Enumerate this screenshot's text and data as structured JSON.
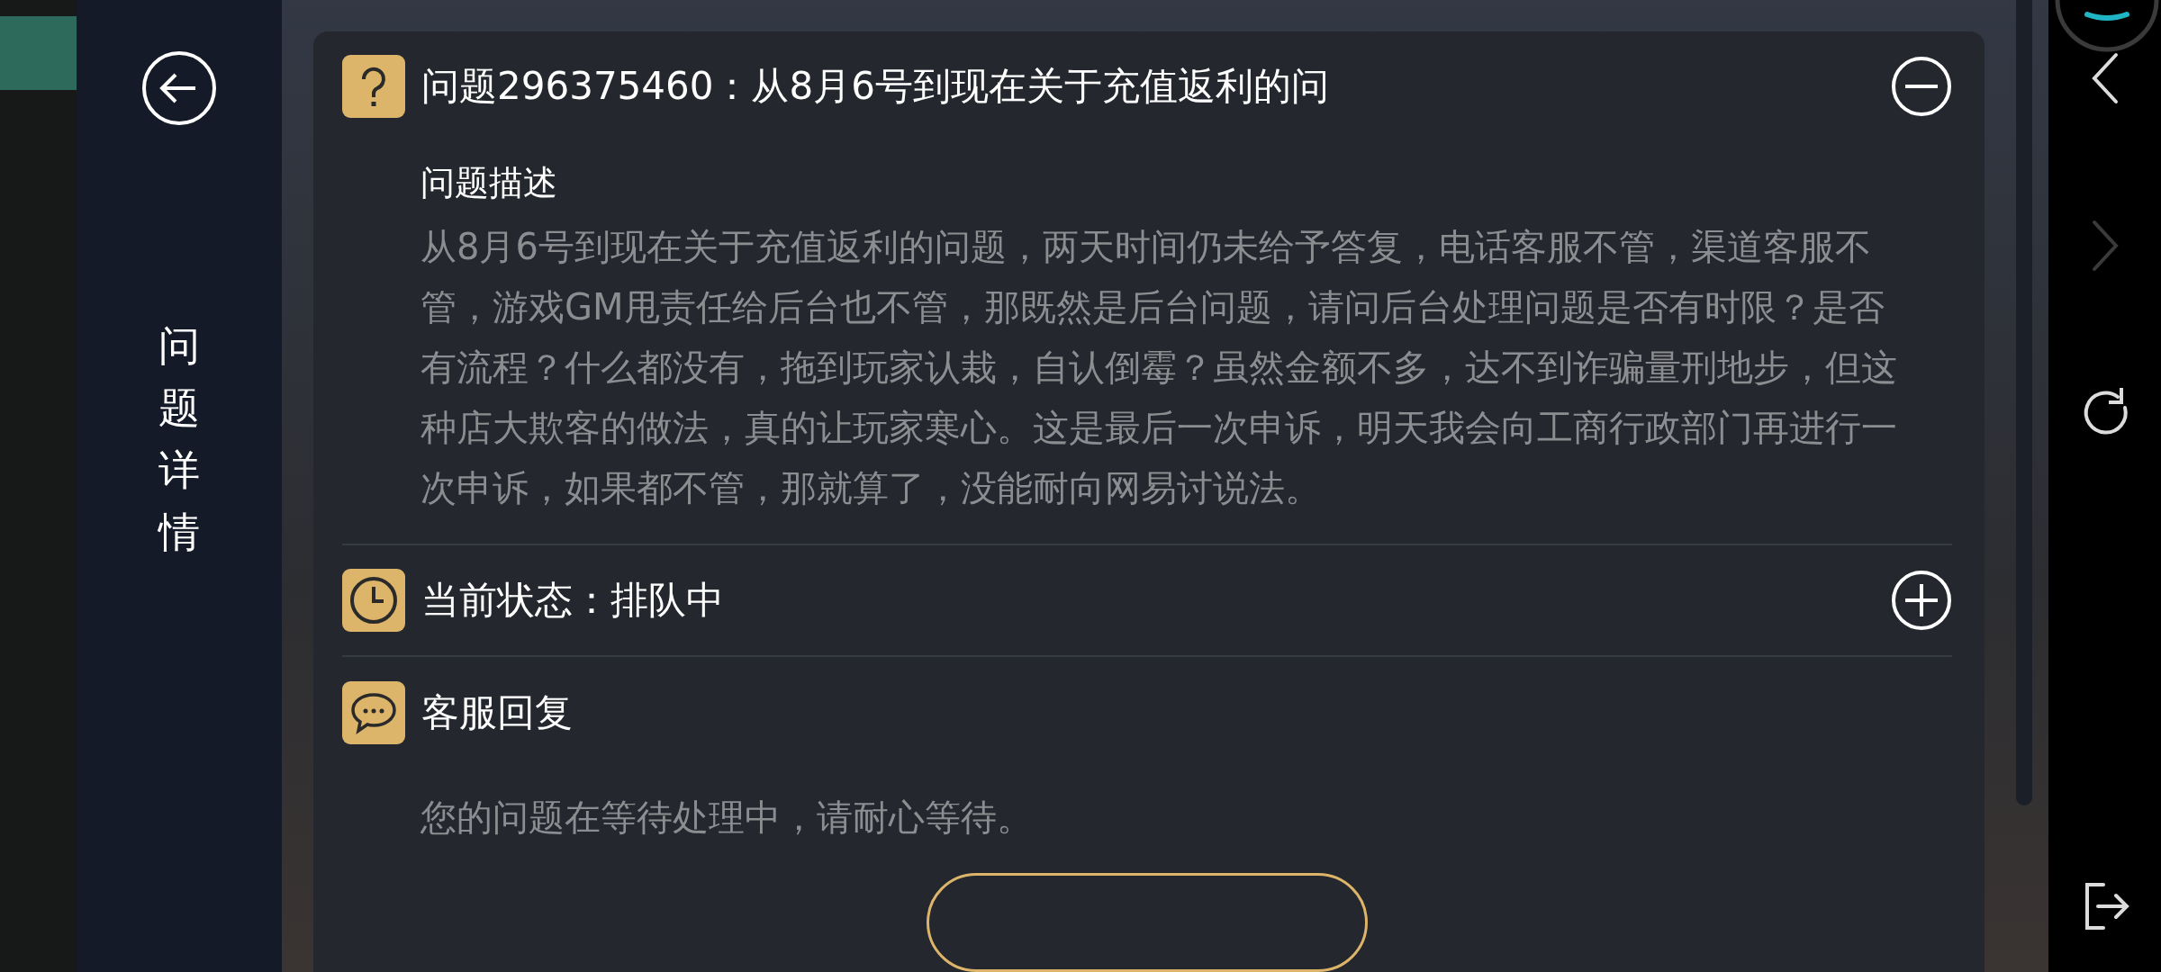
{
  "sidebar": {
    "title": "问题详情"
  },
  "sections": [
    {
      "kind": "question",
      "title": "问题296375460：从8月6号到现在关于充值返利的问",
      "expanded": true,
      "subtitle": "问题描述",
      "body": "从8月6号到现在关于充值返利的问题，两天时间仍未给予答复，电话客服不管，渠道客服不管，游戏GM甩责任给后台也不管，那既然是后台问题，请问后台处理问题是否有时限？是否有流程？什么都没有，拖到玩家认栽，自认倒霉？虽然金额不多，达不到诈骗量刑地步，但这种店大欺客的做法，真的让玩家寒心。这是最后一次申诉，明天我会向工商行政部门再进行一次申诉，如果都不管，那就算了，没能耐向网易讨说法。"
    },
    {
      "kind": "status",
      "title": "当前状态：排队中",
      "expanded": false
    },
    {
      "kind": "reply",
      "title": "客服回复",
      "body": "您的问题在等待处理中，请耐心等待。"
    }
  ],
  "nav_buttons": [
    {
      "kind": "back",
      "disabled": false
    },
    {
      "kind": "forward",
      "disabled": true
    },
    {
      "kind": "refresh",
      "disabled": false
    },
    {
      "kind": "exit",
      "disabled": false
    }
  ]
}
